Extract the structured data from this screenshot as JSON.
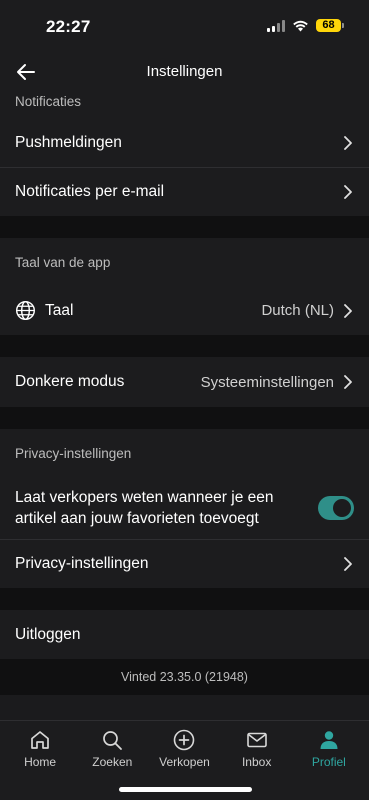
{
  "status_bar": {
    "time": "22:27",
    "battery": "68"
  },
  "header": {
    "title": "Instellingen",
    "back_icon": "arrow-left-icon"
  },
  "notifications": {
    "header": "Notificaties",
    "items": [
      {
        "label": "Pushmeldingen"
      },
      {
        "label": "Notificaties per e-mail"
      }
    ]
  },
  "language": {
    "header": "Taal van de app",
    "label": "Taal",
    "value": "Dutch (NL)",
    "icon": "globe-icon"
  },
  "dark_mode": {
    "label": "Donkere modus",
    "value": "Systeeminstellingen"
  },
  "privacy": {
    "header": "Privacy-instellingen",
    "toggle_label": "Laat verkopers weten wanneer je een artikel aan jouw favorieten toevoegt",
    "toggle_on": true,
    "settings_label": "Privacy-instellingen"
  },
  "logout": {
    "label": "Uitloggen"
  },
  "version": "Vinted 23.35.0 (21948)",
  "tabbar": {
    "accent": "#2fa6a0",
    "tabs": [
      {
        "label": "Home",
        "icon": "home-icon"
      },
      {
        "label": "Zoeken",
        "icon": "search-icon"
      },
      {
        "label": "Verkopen",
        "icon": "plus-circle-icon"
      },
      {
        "label": "Inbox",
        "icon": "mail-icon"
      },
      {
        "label": "Profiel",
        "icon": "person-icon",
        "active": true
      }
    ]
  }
}
